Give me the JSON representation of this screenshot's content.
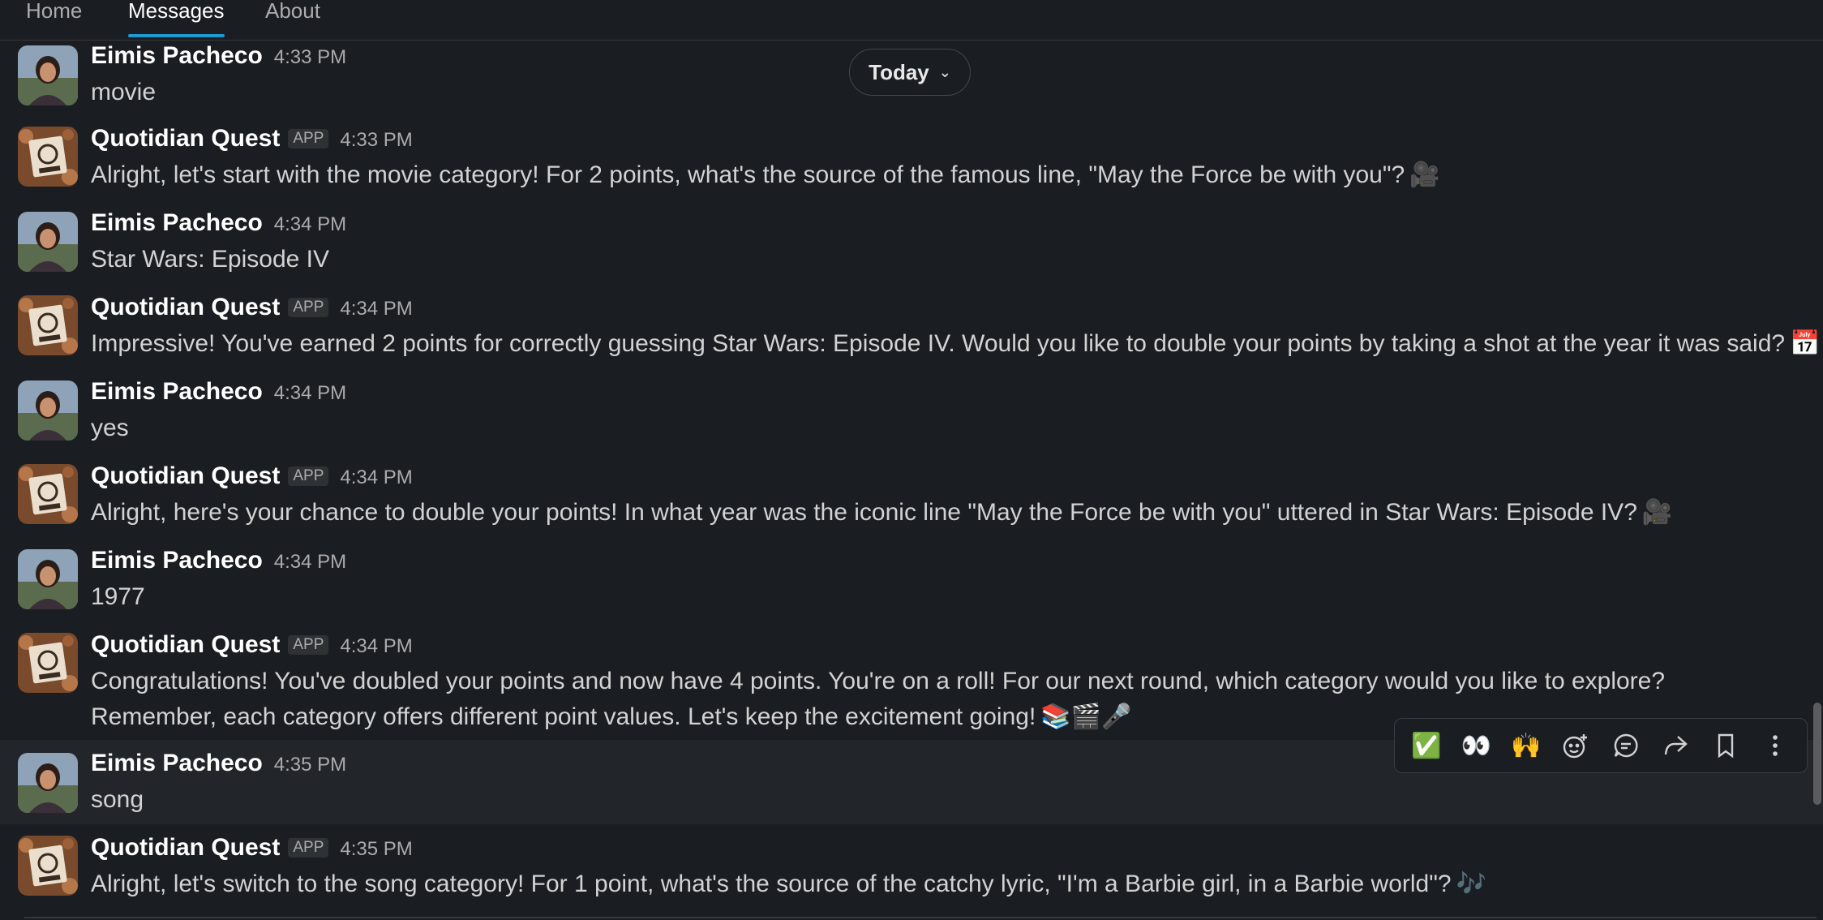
{
  "tabs": [
    {
      "label": "Home",
      "active": false
    },
    {
      "label": "Messages",
      "active": true
    },
    {
      "label": "About",
      "active": false
    }
  ],
  "date_divider": {
    "label": "Today",
    "icon": "chevron-down-icon"
  },
  "messages": [
    {
      "sender": "Eimis Pacheco",
      "time": "4:33 PM",
      "text": "movie",
      "is_app": false
    },
    {
      "sender": "Quotidian Quest",
      "badge": "APP",
      "time": "4:33 PM",
      "text": "Alright, let's start with the movie category! For 2 points, what's the source of the famous line, \"May the Force be with you\"?",
      "emoji": "🎥",
      "is_app": true
    },
    {
      "sender": "Eimis Pacheco",
      "time": "4:34 PM",
      "text": "Star Wars: Episode IV",
      "is_app": false
    },
    {
      "sender": "Quotidian Quest",
      "badge": "APP",
      "time": "4:34 PM",
      "text": "Impressive! You've earned 2 points for correctly guessing Star Wars: Episode IV. Would you like to double your points by taking a shot at the year it was said?",
      "emoji": "📅",
      "is_app": true
    },
    {
      "sender": "Eimis Pacheco",
      "time": "4:34 PM",
      "text": "yes",
      "is_app": false
    },
    {
      "sender": "Quotidian Quest",
      "badge": "APP",
      "time": "4:34 PM",
      "text": "Alright, here's your chance to double your points! In what year was the iconic line \"May the Force be with you\" uttered in Star Wars: Episode IV?",
      "emoji": "🎥",
      "is_app": true
    },
    {
      "sender": "Eimis Pacheco",
      "time": "4:34 PM",
      "text": "1977",
      "is_app": false
    },
    {
      "sender": "Quotidian Quest",
      "badge": "APP",
      "time": "4:34 PM",
      "text": "Congratulations! You've doubled your points and now have 4 points. You're on a roll! For our next round, which category would you like to explore? Remember, each category offers different point values. Let's keep the excitement going!",
      "emoji": "📚🎬🎤",
      "is_app": true
    },
    {
      "sender": "Eimis Pacheco",
      "time": "4:35 PM",
      "text": "song",
      "is_app": false
    },
    {
      "sender": "Quotidian Quest",
      "badge": "APP",
      "time": "4:35 PM",
      "text": "Alright, let's switch to the song category! For 1 point, what's the source of the catchy lyric, \"I'm a Barbie girl, in a Barbie world\"?",
      "emoji": "🎶",
      "is_app": true
    }
  ],
  "message_actions": [
    {
      "name": "white-check-mark-reaction",
      "glyph": "✅"
    },
    {
      "name": "eyes-reaction",
      "glyph": "👀"
    },
    {
      "name": "raised-hands-reaction",
      "glyph": "🙌"
    },
    {
      "name": "add-reaction-icon"
    },
    {
      "name": "reply-in-thread-icon"
    },
    {
      "name": "forward-message-icon"
    },
    {
      "name": "save-for-later-icon"
    },
    {
      "name": "more-actions-icon"
    }
  ],
  "colors": {
    "background": "#1a1d21",
    "hover_row": "#222529",
    "active_tab_underline": "#1d9bd1",
    "name_text": "#ffffff",
    "body_text": "#d1d2d3",
    "muted_text": "#ababad"
  }
}
